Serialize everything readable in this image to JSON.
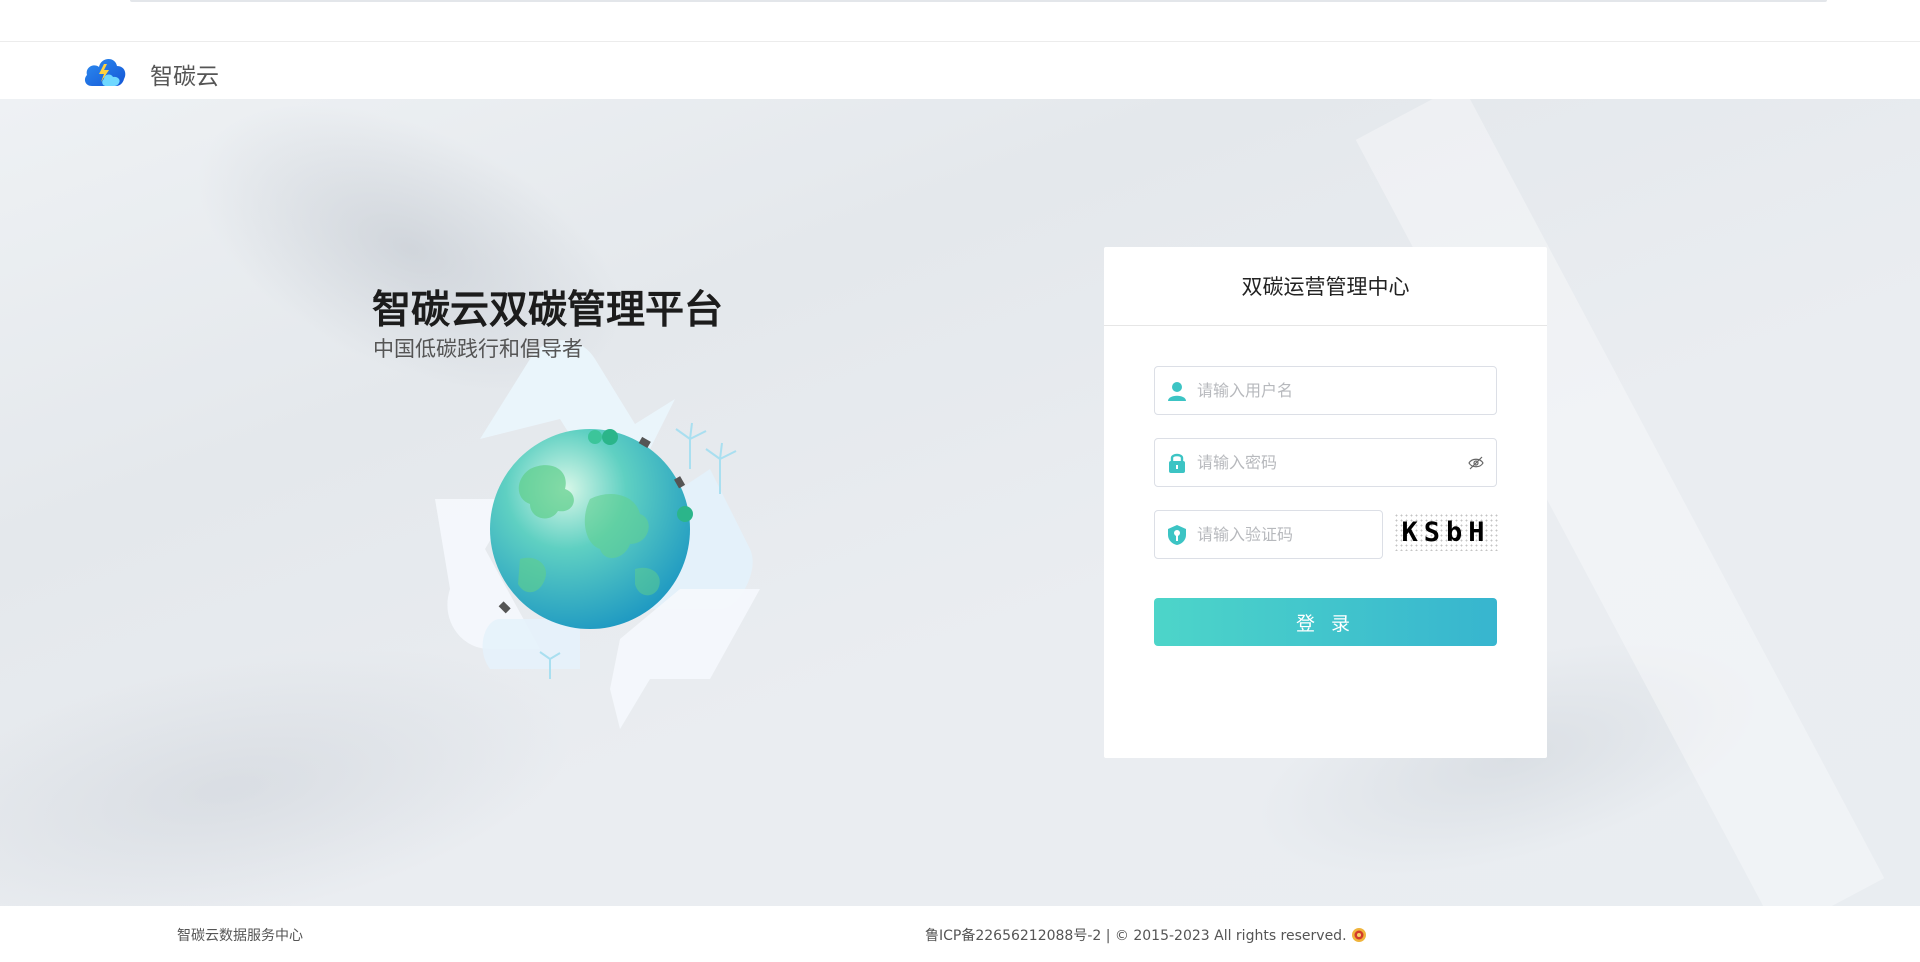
{
  "header": {
    "brand": "智碳云",
    "logo_icon": "cloud-lightning-icon"
  },
  "hero": {
    "title": "智碳云双碳管理平台",
    "subtitle": "中国低碳践行和倡导者"
  },
  "login": {
    "title": "双碳运营管理中心",
    "username": {
      "placeholder": "请输入用户名",
      "value": "",
      "icon": "user-icon"
    },
    "password": {
      "placeholder": "请输入密码",
      "value": "",
      "icon": "lock-icon",
      "toggle_icon": "eye-off-icon"
    },
    "captcha": {
      "placeholder": "请输入验证码",
      "value": "",
      "icon": "shield-key-icon",
      "image_text": "KSbH"
    },
    "submit_label": "登 录"
  },
  "footer": {
    "left": "智碳云数据服务中心",
    "center": "鲁ICP备22656212088号-2 | © 2015-2023 All rights reserved.",
    "badge_icon": "police-badge-icon"
  },
  "colors": {
    "accent_start": "#4dd5c9",
    "accent_end": "#37b5cf",
    "icon_teal": "#3cc4c4"
  }
}
